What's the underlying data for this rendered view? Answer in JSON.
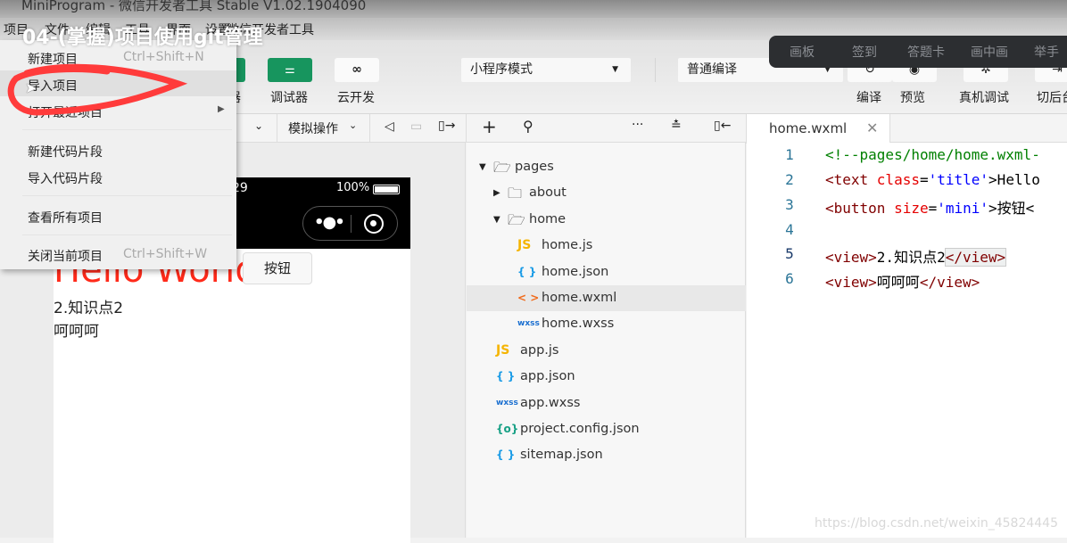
{
  "window": {
    "title": "MiniProgram - 微信开发者工具 Stable V1.02.1904090"
  },
  "menubar": [
    "项目",
    "文件",
    "编辑",
    "工具",
    "界面",
    "设置",
    "微信开发者工具"
  ],
  "overlay_title": "04-(掌握)项目使用git管理",
  "toolbar": {
    "debugger": "调试器",
    "cloud": "云开发",
    "mode": "小程序模式",
    "compile_mode": "普通编译",
    "compile": "编译",
    "preview": "预览",
    "remote_debug": "真机调试",
    "background": "切后台",
    "editor_partial": "器"
  },
  "dark_bar": [
    "画板",
    "签到",
    "答题卡",
    "画中画",
    "举手"
  ],
  "sim_toolbar": {
    "simulate": "模拟操作"
  },
  "phone": {
    "time": "29",
    "battery": "100%",
    "title": "Hello World",
    "button": "按钮",
    "line1": "2.知识点2",
    "line2": "呵呵呵",
    "title_color": "#ff2a1a"
  },
  "menu": {
    "items": [
      {
        "label": "新建项目",
        "shortcut": "Ctrl+Shift+N"
      },
      {
        "label": "导入项目",
        "shortcut": ""
      },
      {
        "label": "打开最近项目",
        "shortcut": ""
      },
      {
        "label": "新建代码片段",
        "shortcut": ""
      },
      {
        "label": "导入代码片段",
        "shortcut": ""
      },
      {
        "label": "查看所有项目",
        "shortcut": ""
      },
      {
        "label": "关闭当前项目",
        "shortcut": "Ctrl+Shift+W"
      }
    ]
  },
  "tree": [
    {
      "name": "pages",
      "icon": "folder-open",
      "indent": 0,
      "arrow": "▼"
    },
    {
      "name": "about",
      "icon": "folder",
      "indent": 1,
      "arrow": "▶"
    },
    {
      "name": "home",
      "icon": "folder-open",
      "indent": 1,
      "arrow": "▼"
    },
    {
      "name": "home.js",
      "icon": "JS",
      "indent": 2
    },
    {
      "name": "home.json",
      "icon": "{ }",
      "indent": 2
    },
    {
      "name": "home.wxml",
      "icon": "< >",
      "indent": 2,
      "selected": true
    },
    {
      "name": "home.wxss",
      "icon": "wxss",
      "indent": 2
    },
    {
      "name": "app.js",
      "icon": "JS",
      "indent": 1
    },
    {
      "name": "app.json",
      "icon": "{ }",
      "indent": 1
    },
    {
      "name": "app.wxss",
      "icon": "wxss",
      "indent": 1
    },
    {
      "name": "project.config.json",
      "icon": "{o}",
      "indent": 1
    },
    {
      "name": "sitemap.json",
      "icon": "{ }",
      "indent": 1
    }
  ],
  "editor": {
    "tab": "home.wxml",
    "lines": [
      "1",
      "2",
      "3",
      "4",
      "5",
      "6"
    ],
    "code": {
      "l1": "<!--pages/home/home.wxml-",
      "l2a": "<text ",
      "l2b": "class",
      "l2c": "=",
      "l2d": "'title'",
      "l2e": ">Hello",
      "l3a": "<button ",
      "l3b": "size",
      "l3c": "=",
      "l3d": "'mini'",
      "l3e": ">按钮<",
      "l5a": "<view>",
      "l5b": "2.知识点2",
      "l5c": "</view>",
      "l6a": "<view>",
      "l6b": "呵呵呵",
      "l6c": "</view>"
    }
  },
  "watermark": "https://blog.csdn.net/weixin_45824445"
}
